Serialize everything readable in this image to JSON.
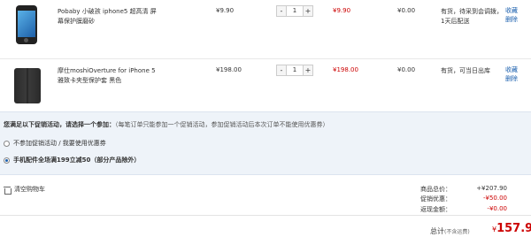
{
  "items": [
    {
      "title": "Pobaby 小破孩 iphone5 超高清 屏幕保护膜磨砂",
      "price": "¥9.90",
      "qty": "1",
      "subtotal": "¥9.90",
      "discount": "¥0.00",
      "stock": "有货，待采到会调拨，1天后配送",
      "action_fav": "收藏",
      "action_del": "删除",
      "thumb_icon": "phone-screen-protector-image"
    },
    {
      "title": "摩仕moshiOverture for iPhone 5 雅致卡夹型保护套 黑色",
      "price": "¥198.00",
      "qty": "1",
      "subtotal": "¥198.00",
      "discount": "¥0.00",
      "stock": "有货，可当日出库",
      "action_fav": "收藏",
      "action_del": "删除",
      "thumb_icon": "phone-case-image"
    }
  ],
  "qty_minus": "-",
  "qty_plus": "+",
  "promo": {
    "head_bold": "您满足以下促销活动，请选择一个参加：",
    "head_note": "（每笔订单只能参加一个促销活动，参加促销活动后本次订单不能使用优惠券）",
    "option1": "不参加促销活动 / 我要使用优惠券",
    "option2": "手机配件全场满199立减50（部分产品除外）"
  },
  "clear_cart": "清空购物车",
  "summary": {
    "goods_label": "商品总价：",
    "goods_value": "+¥207.90",
    "promo_label": "促销优惠：",
    "promo_value": "-¥50.00",
    "rebate_label": "返现金额：",
    "rebate_value": "-¥0.00",
    "total_label": "总计",
    "total_note": "(不含运费)",
    "total_currency": "¥",
    "total_value": "157.90"
  },
  "colors": {
    "accent_red": "#cc0000",
    "link_blue": "#1a5fae",
    "promo_bg": "#eef3f9"
  }
}
